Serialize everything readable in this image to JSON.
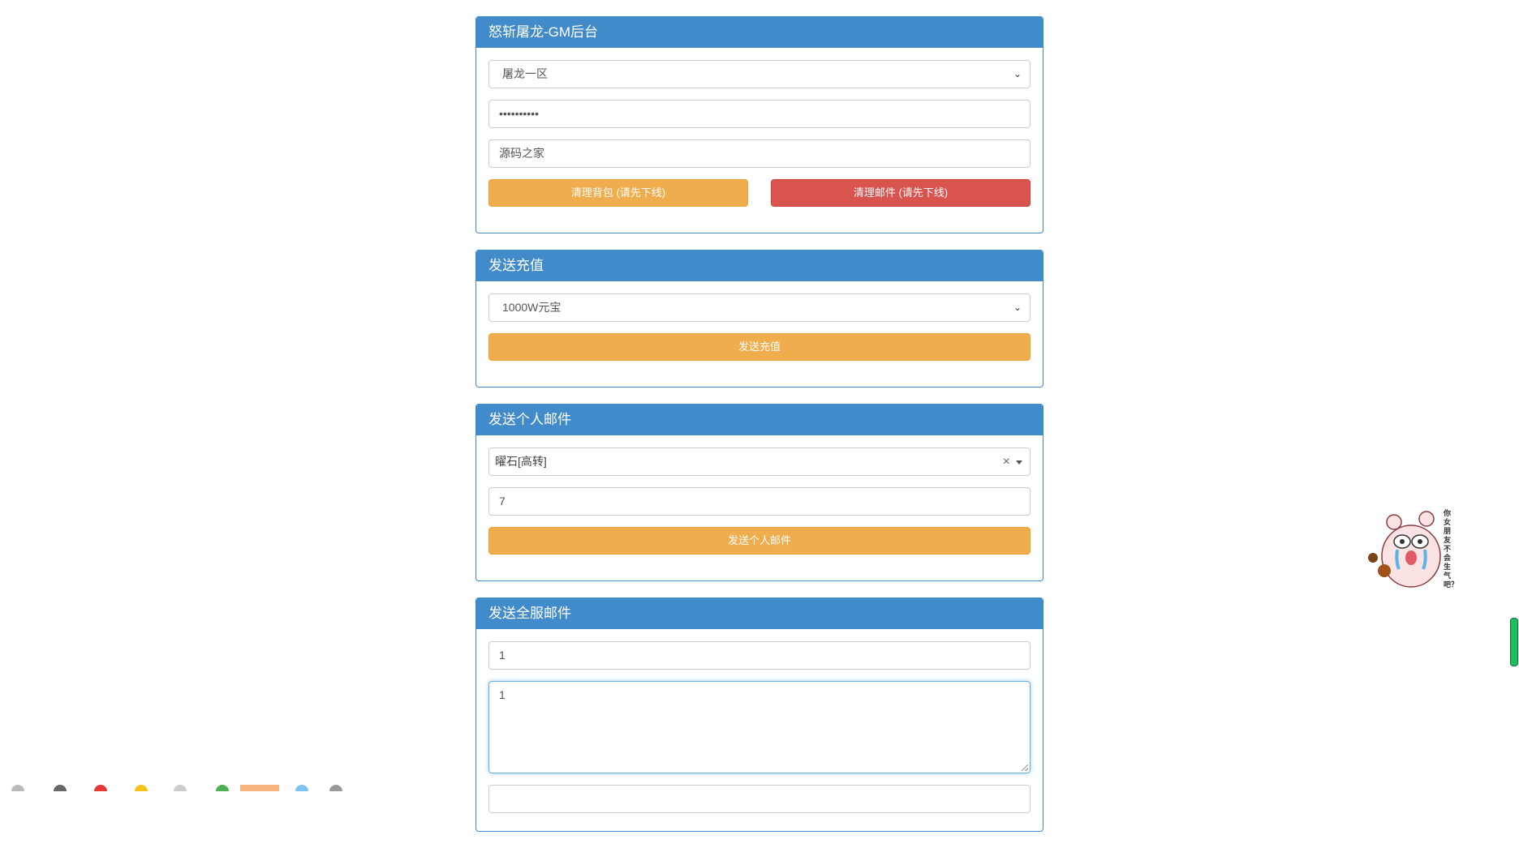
{
  "panel1": {
    "title": "怒斩屠龙-GM后台",
    "server_select": "屠龙一区",
    "password_value": "••••••••••",
    "name_value": "源码之家",
    "clear_bag_btn": "清理背包 (请先下线)",
    "clear_mail_btn": "清理邮件 (请先下线)"
  },
  "panel2": {
    "title": "发送充值",
    "amount_select": "1000W元宝",
    "send_btn": "发送充值"
  },
  "panel3": {
    "title": "发送个人邮件",
    "item_select": "曜石[高转]",
    "quantity_value": "7",
    "send_btn": "发送个人邮件"
  },
  "panel4": {
    "title": "发送全服邮件",
    "subject_value": "1",
    "body_value": "1"
  },
  "mascot": {
    "caption": "你女朋友不会生气吧？"
  },
  "colors": {
    "primary": "#428bca",
    "warning": "#f0ad4e",
    "danger": "#d9534f"
  }
}
